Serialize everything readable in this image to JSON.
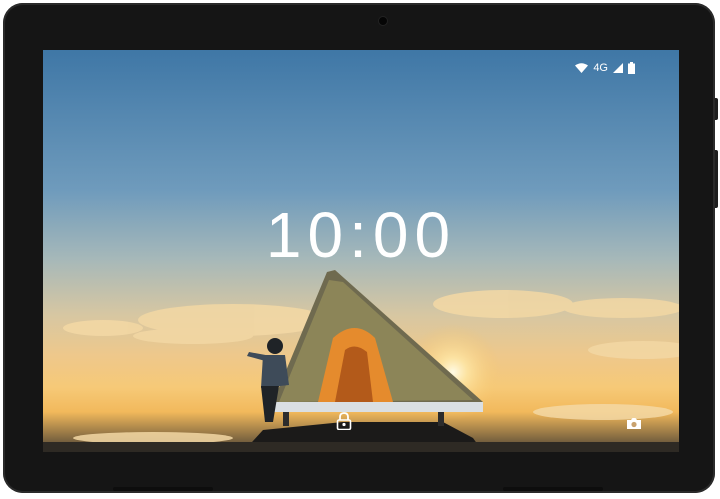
{
  "status_bar": {
    "network_label": "4G",
    "wifi_icon": "wifi-icon",
    "signal_icon": "signal-icon",
    "battery_icon": "battery-icon"
  },
  "lock_screen": {
    "time": "10:00",
    "lock_icon": "lock-icon",
    "camera_icon": "camera-icon"
  },
  "colors": {
    "sky_top": "#3f77a6",
    "sunset_glow": "#f6c977",
    "bezel": "#151515"
  }
}
